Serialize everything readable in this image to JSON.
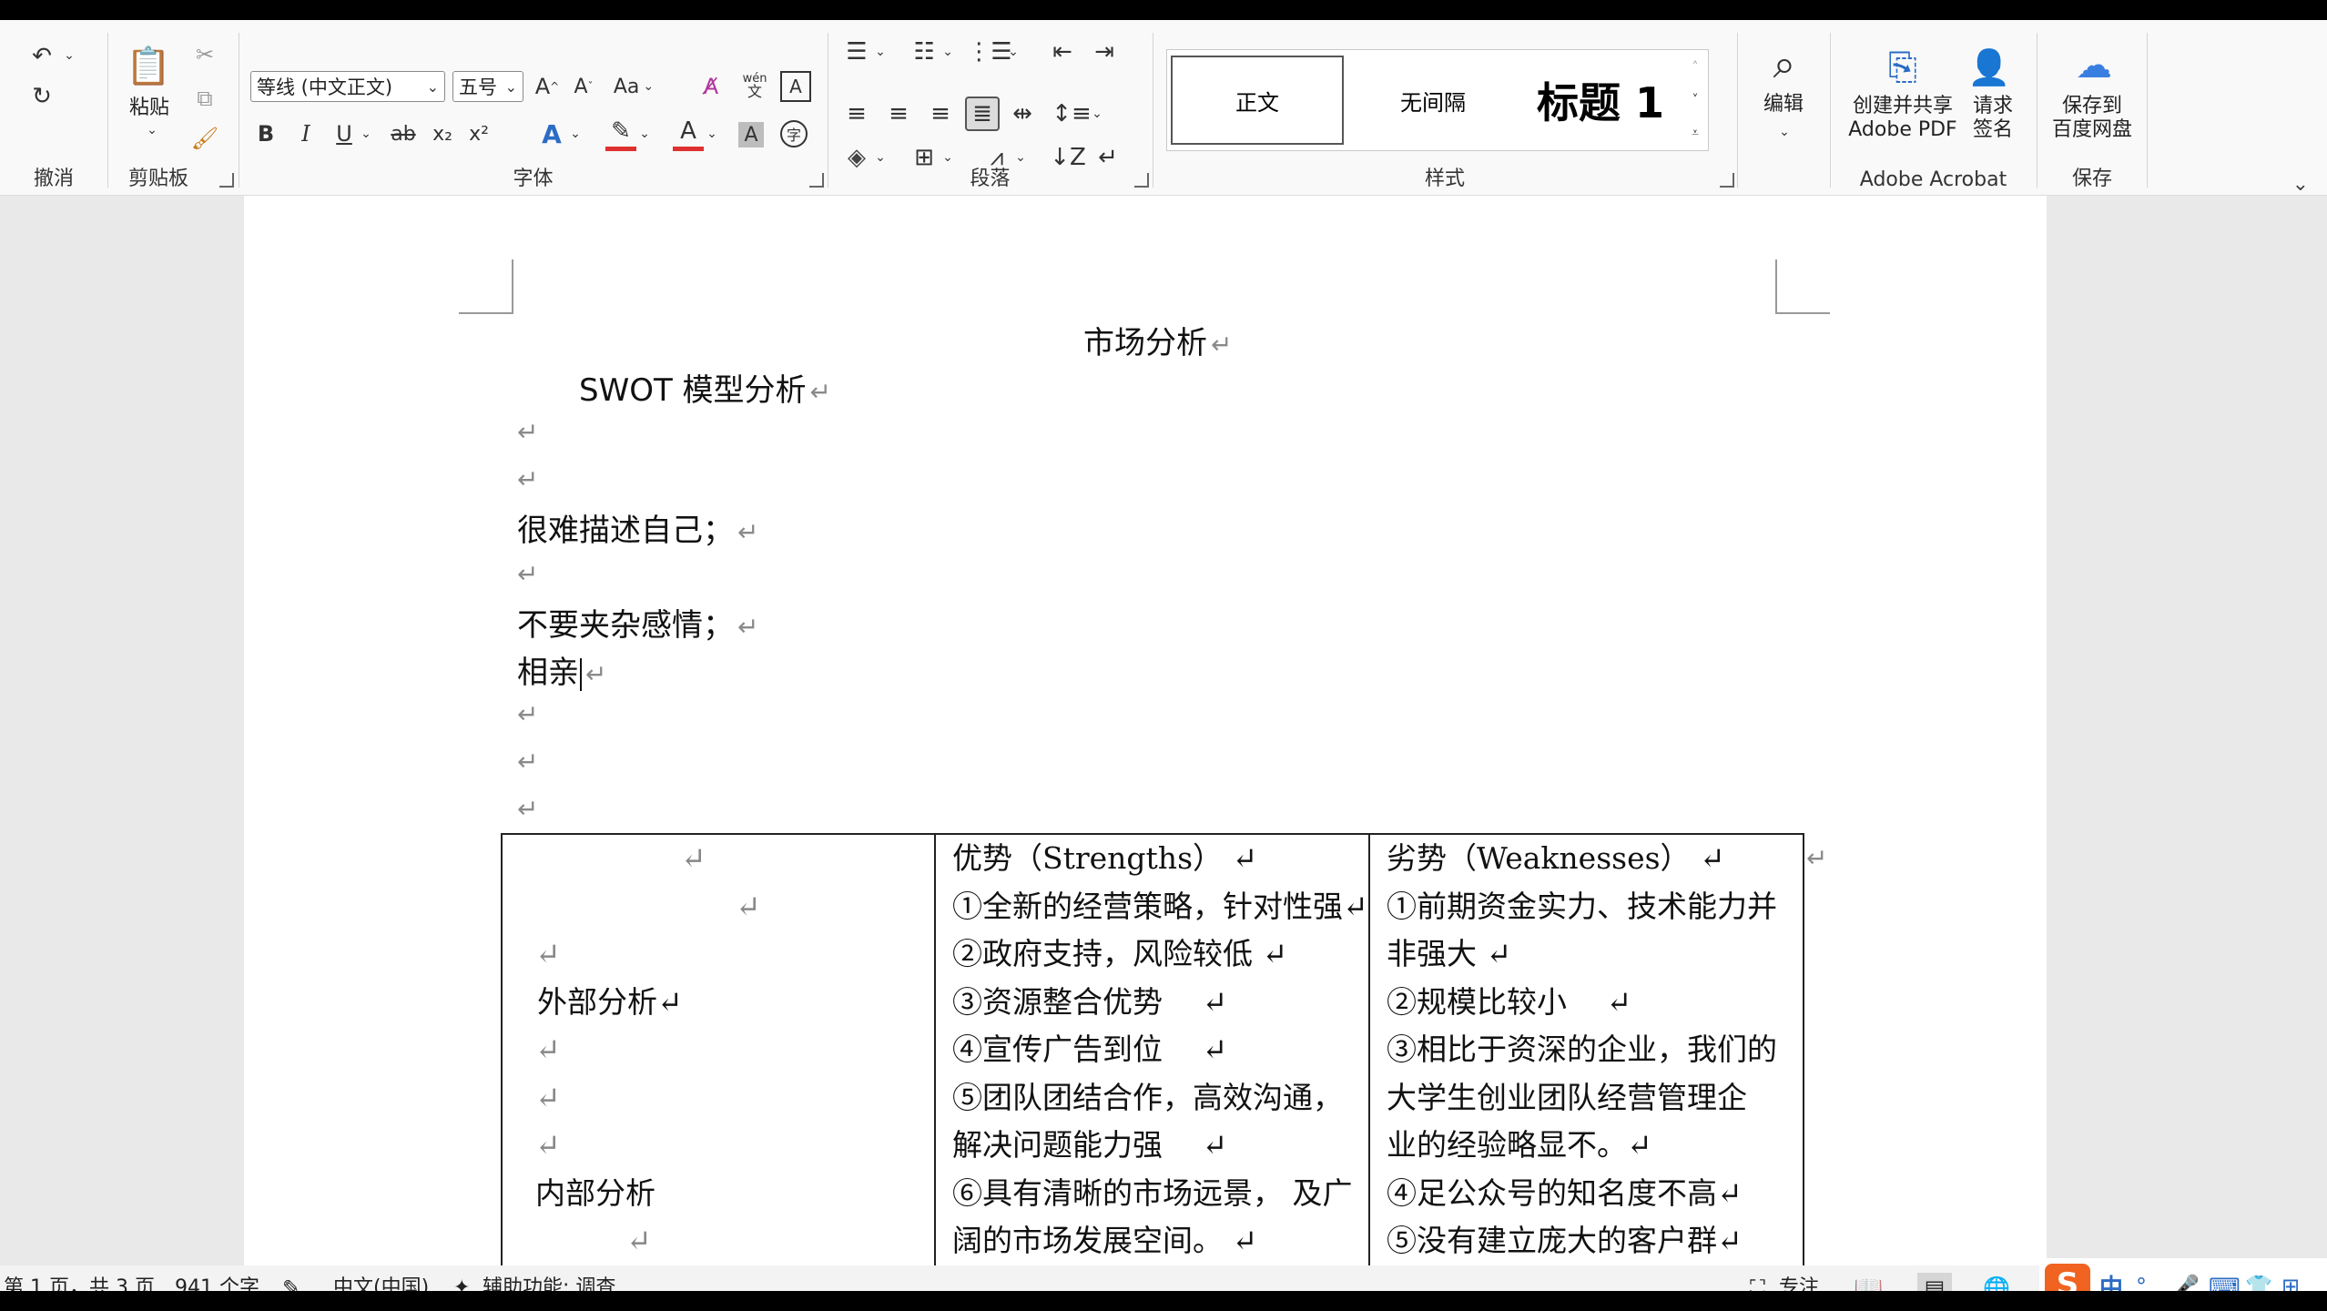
{
  "ribbon": {
    "undo": {
      "group_label": "撤消"
    },
    "clipboard": {
      "paste_label": "粘贴",
      "group_label": "剪贴板"
    },
    "font": {
      "font_name": "等线 (中文正文)",
      "font_size": "五号",
      "case_label": "Aa",
      "pinyin_top": "wén",
      "pinyin_bottom": "文",
      "char_border": "A",
      "bold": "B",
      "italic": "I",
      "underline": "U",
      "strike": "ab",
      "subscript": "x₂",
      "superscript": "x²",
      "effects": "A",
      "highlight": "A",
      "color": "A",
      "shading": "A",
      "enclose": "字",
      "group_label": "字体"
    },
    "paragraph": {
      "group_label": "段落"
    },
    "styles": {
      "normal": "正文",
      "no_spacing": "无间隔",
      "heading1": "标题 1",
      "group_label": "样式"
    },
    "editing": {
      "label": "编辑"
    },
    "acrobat": {
      "create_line1": "创建并共享",
      "create_line2": "Adobe PDF",
      "sign_line1": "请求",
      "sign_line2": "签名",
      "group_label": "Adobe Acrobat"
    },
    "save": {
      "line1": "保存到",
      "line2": "百度网盘",
      "group_label": "保存"
    }
  },
  "document": {
    "title": "市场分析",
    "subtitle": "SWOT 模型分析",
    "line1": "很难描述自己；",
    "line2": "不要夹杂感情；",
    "line3": "相亲",
    "paragraph_mark": "↵",
    "table": {
      "col1": [
        "↵",
        "↵",
        "↵",
        "外部分析↵",
        "↵",
        "↵",
        "↵",
        "内部分析",
        "↵"
      ],
      "col2": [
        "优势（Strengths） ↵",
        "①全新的经营策略，针对性强↵",
        "②政府支持，风险较低 ↵",
        "③资源整合优势　 ↵",
        "④宣传广告到位　 ↵",
        "⑤团队团结合作，高效沟通，",
        "解决问题能力强　 ↵",
        "⑥具有清晰的市场远景， 及广",
        "阔的市场发展空间。 ↵"
      ],
      "col3": [
        "劣势（Weaknesses） ↵",
        "①前期资金实力、技术能力并",
        "非强大 ↵",
        "②规模比较小　 ↵",
        "③相比于资深的企业，我们的",
        "大学生创业团队经营管理企",
        "业的经验略显不。↵",
        "④足公众号的知名度不高↵",
        "⑤没有建立庞大的客户群↵"
      ]
    }
  },
  "status": {
    "page": "第 1 页，共 3 页",
    "words": "941 个字",
    "language": "中文(中国)",
    "accessibility": "辅助功能: 调查",
    "focus": "专注",
    "ime": "中"
  },
  "colors": {
    "accent_blue": "#2b6cc4",
    "highlight_red": "#e03030",
    "doc_bg": "#e9e9e9"
  }
}
